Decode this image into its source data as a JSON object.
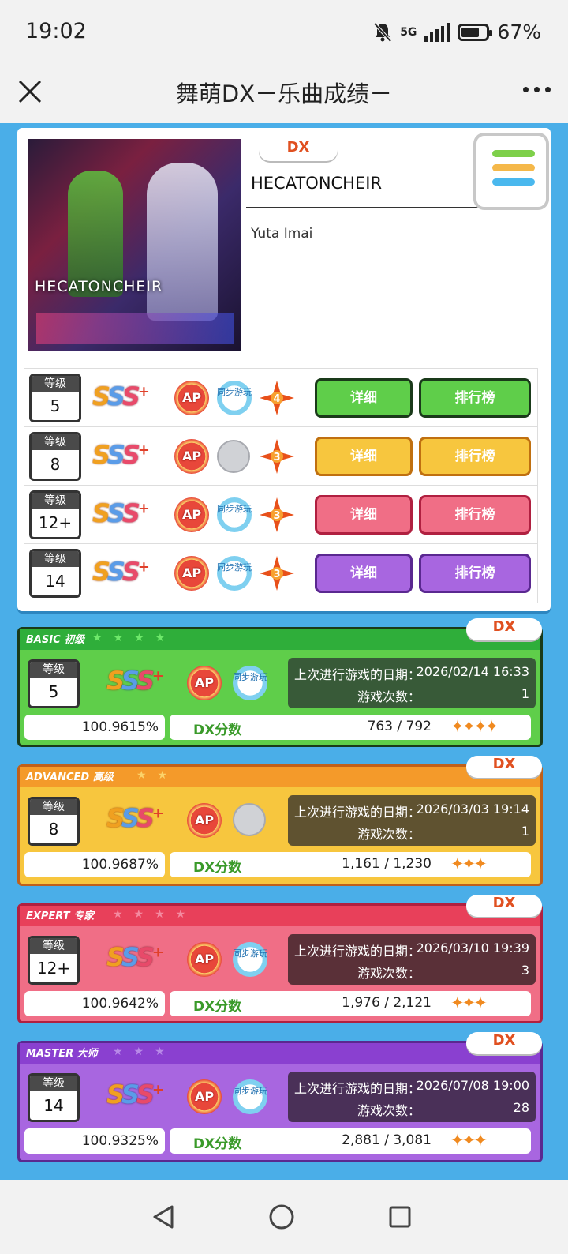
{
  "status": {
    "time": "19:02",
    "network": "5G",
    "battery": "67%"
  },
  "titlebar": {
    "title": "舞萌DX－乐曲成绩－"
  },
  "song": {
    "type": "DX",
    "name": "HECATONCHEIR",
    "artist": "Yuta Imai",
    "jacket_title": "HECATONCHEIR"
  },
  "diff_rows": [
    {
      "level_label": "等级",
      "level": "5",
      "dx_stars": "4",
      "detail": "详细",
      "ranking": "排行榜",
      "sync": "同步游玩"
    },
    {
      "level_label": "等级",
      "level": "8",
      "dx_stars": "3",
      "detail": "详细",
      "ranking": "排行榜",
      "sync": ""
    },
    {
      "level_label": "等级",
      "level": "12+",
      "dx_stars": "3",
      "detail": "详细",
      "ranking": "排行榜",
      "sync": "同步游玩"
    },
    {
      "level_label": "等级",
      "level": "14",
      "dx_stars": "3",
      "detail": "详细",
      "ranking": "排行榜",
      "sync": "同步游玩"
    }
  ],
  "rank_text": {
    "s": "S",
    "plus": "+",
    "ap": "AP"
  },
  "cards": [
    {
      "band": "BASIC 初级",
      "dx": "DX",
      "level_label": "等级",
      "level": "5",
      "last_played_label": "上次进行游戏的日期：",
      "last_played": "2026/02/14 16:33",
      "play_count_label": "游戏次数：",
      "play_count": "1",
      "achievement": "100.9615%",
      "dx_score_label": "DX分数",
      "dx_score": "763 / 792",
      "stars": "✦✦✦✦",
      "sync": "同步游玩"
    },
    {
      "band": "ADVANCED 高级",
      "dx": "DX",
      "level_label": "等级",
      "level": "8",
      "last_played_label": "上次进行游戏的日期：",
      "last_played": "2026/03/03 19:14",
      "play_count_label": "游戏次数：",
      "play_count": "1",
      "achievement": "100.9687%",
      "dx_score_label": "DX分数",
      "dx_score": "1,161 / 1,230",
      "stars": "✦✦✦",
      "sync": ""
    },
    {
      "band": "EXPERT 专家",
      "dx": "DX",
      "level_label": "等级",
      "level": "12+",
      "last_played_label": "上次进行游戏的日期：",
      "last_played": "2026/03/10 19:39",
      "play_count_label": "游戏次数：",
      "play_count": "3",
      "achievement": "100.9642%",
      "dx_score_label": "DX分数",
      "dx_score": "1,976 / 2,121",
      "stars": "✦✦✦",
      "sync": "同步游玩"
    },
    {
      "band": "MASTER 大师",
      "dx": "DX",
      "level_label": "等级",
      "level": "14",
      "last_played_label": "上次进行游戏的日期：",
      "last_played": "2026/07/08 19:00",
      "play_count_label": "游戏次数：",
      "play_count": "28",
      "achievement": "100.9325%",
      "dx_score_label": "DX分数",
      "dx_score": "2,881 / 3,081",
      "stars": "✦✦✦",
      "sync": "同步游玩"
    }
  ],
  "colors": {
    "basic": "#5fce4a",
    "advanced": "#f7c63e",
    "expert": "#f06e86",
    "master": "#a866e0",
    "page_bg": "#4aaee8"
  }
}
